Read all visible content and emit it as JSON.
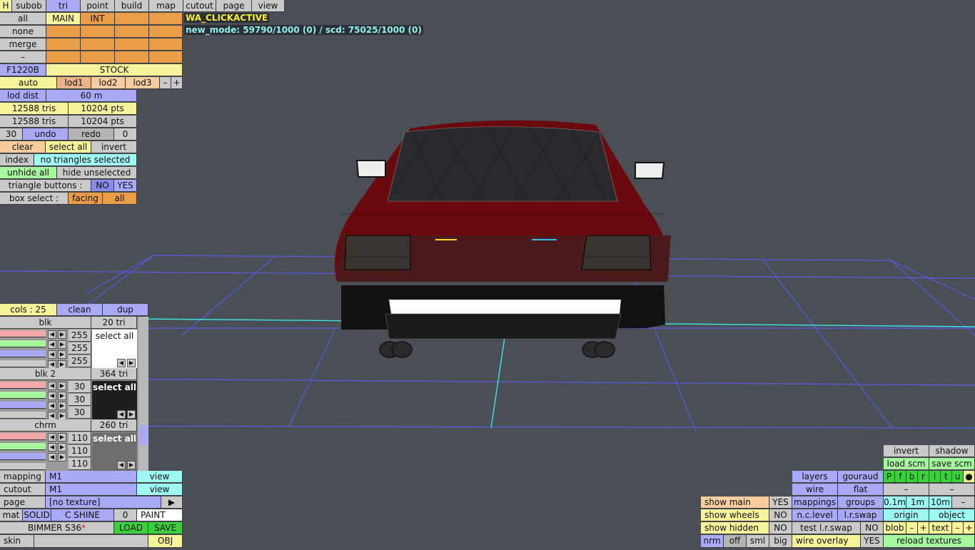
{
  "toolbar": {
    "items": [
      "H",
      "subob",
      "tri",
      "point",
      "build",
      "map",
      "cutout",
      "page",
      "view"
    ]
  },
  "overlay": {
    "status": "WA_CLICKACTIVE",
    "modes": "new_mode: 59790/1000 (0) / scd: 75025/1000 (0)"
  },
  "selpanel": {
    "all": "all",
    "main": "MAIN",
    "int": "INT",
    "none": "none",
    "merge": "merge",
    "dash": "–"
  },
  "model": {
    "name": "F1220B",
    "variant": "STOCK"
  },
  "lod": {
    "auto": "auto",
    "lod1": "lod1",
    "lod2": "lod2",
    "lod3": "lod3",
    "minus": "–",
    "plus": "+",
    "dist_label": "lod dist",
    "dist_value": "60 m"
  },
  "stats": {
    "tris1": "12588 tris",
    "pts1": "10204 pts",
    "tris2": "12588 tris",
    "pts2": "10204 pts"
  },
  "history": {
    "count": "30",
    "undo": "undo",
    "redo": "redo",
    "redo_count": "0"
  },
  "select": {
    "clear": "clear",
    "select_all": "select all",
    "invert": "invert",
    "index": "index",
    "info": "no triangles selected",
    "unhide_all": "unhide all",
    "hide_unselected": "hide unselected"
  },
  "triangle_buttons": {
    "label": "triangle buttons :",
    "no": "NO",
    "yes": "YES"
  },
  "box_select": {
    "label": "box select :",
    "facing": "facing",
    "all": "all"
  },
  "colors": {
    "cols": "cols : 25",
    "clean": "clean",
    "dup": "dup"
  },
  "materials": [
    {
      "name": "blk",
      "tris": "20 tri",
      "r": "255",
      "g": "255",
      "b": "255",
      "select": "select all",
      "swatch": "#ffffff",
      "text": "#111111"
    },
    {
      "name": "blk 2",
      "tris": "364 tri",
      "r": "30",
      "g": "30",
      "b": "30",
      "select": "select all",
      "swatch": "#1e1e1e",
      "text": "#ffffff"
    },
    {
      "name": "chrm",
      "tris": "260 tri",
      "r": "110",
      "g": "110",
      "b": "110",
      "select": "select all",
      "swatch": "#6e6e6e",
      "text": "#ffffff"
    }
  ],
  "bottom_left": {
    "mapping": "mapping",
    "mapping_val": "M1",
    "mapping_view": "view",
    "cutout": "cutout",
    "cutout_val": "M1",
    "cutout_view": "view",
    "page": "page",
    "page_val": "[no texture]",
    "page_arrow": "▶",
    "mat": "mat",
    "solid": "SOLID",
    "cshine": "C SHINE",
    "zero": "0",
    "paint": "PAINT",
    "car": "BIMMER S36",
    "star": "*",
    "load": "LOAD",
    "save": "SAVE",
    "skin": "skin",
    "obj": "OBJ"
  },
  "bottom_right": {
    "invert": "invert",
    "shadow": "shadow",
    "load_scm": "load scm",
    "save_scm": "save scm",
    "layers": "layers",
    "gouraud": "gouraud",
    "flags": [
      "P",
      "f",
      "b",
      "r",
      "l",
      "t",
      "u",
      "●"
    ],
    "wire": "wire",
    "flat": "flat",
    "dash": "–",
    "show_main": "show main",
    "show_main_v": "YES",
    "mappings": "mappings",
    "groups": "groups",
    "d01": "0.1m",
    "d1": "1m",
    "d10": "10m",
    "show_wheels": "show wheels",
    "show_wheels_v": "NO",
    "nclevel": "n.c.level",
    "lrswap": "l.r.swap",
    "origin": "origin",
    "object": "object",
    "show_hidden": "show hidden",
    "show_hidden_v": "NO",
    "test_lrswap": "test l.r.swap",
    "test_lrswap_v": "NO",
    "blob": "blob",
    "text": "text",
    "nrm": "nrm",
    "off": "off",
    "sml": "sml",
    "big": "big",
    "wire_overlay": "wire overlay",
    "wire_overlay_v": "YES",
    "reload": "reload textures",
    "minus": "–",
    "plus": "+"
  }
}
